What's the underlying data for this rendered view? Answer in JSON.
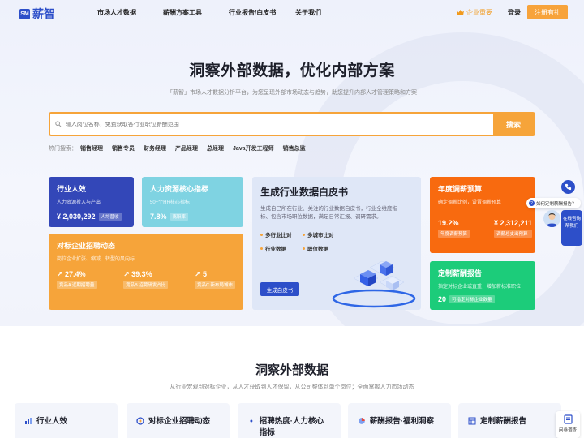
{
  "nav": {
    "logo_mark": "SM",
    "logo_text": "薪智",
    "items": [
      "市场人才数据",
      "薪酬方案工具",
      "行业报告/白皮书",
      "关于我们"
    ],
    "enterprise": "企业重要",
    "login": "登录",
    "register": "注册有礼"
  },
  "hero": {
    "title": "洞察外部数据，优化内部方案",
    "subtitle": "「薪智」市场人才数据分析平台，为您呈现外部市场动态与趋势，助您提升内部人才管理策略和方案"
  },
  "search": {
    "placeholder": "输入岗位名称，免费获取各行业职位薪酬范围",
    "button": "搜索"
  },
  "hot": {
    "label": "热门搜索：",
    "items": [
      "销售经理",
      "销售专员",
      "财务经理",
      "产品经理",
      "总经理",
      "Java开发工程师",
      "销售总监"
    ]
  },
  "cards": {
    "talent": {
      "title": "行业人效",
      "sub": "人力资源投入与产出",
      "value": "¥ 2,030,292",
      "tag": "人均营收"
    },
    "hr": {
      "title": "人力资源核心指标",
      "sub": "50+个HR核心指标",
      "value": "7.8%",
      "tag": "离职率"
    },
    "recruit": {
      "title": "对标企业招聘动态",
      "sub": "岗位企业扩张、缩减、转型的风向标",
      "stats": [
        {
          "value": "27.4%",
          "label": "竞品A 近期招聘量"
        },
        {
          "value": "39.3%",
          "label": "竞品B 招聘研发占比"
        },
        {
          "value": "5",
          "label": "竞品C 新布局城市"
        }
      ]
    },
    "whitepaper": {
      "title": "生成行业数据白皮书",
      "desc": "生成自己所在行业、关注的行业数据白皮书，行业全维度指标、包含市场职位数据，满足日常汇报、调研需求。",
      "features": [
        "多行业比对",
        "多城市比对",
        "行业数据",
        "职位数据"
      ],
      "button": "生成白皮书"
    },
    "budget": {
      "title": "年度调薪预算",
      "sub": "确定调薪比例，设置调薪预算",
      "stats": [
        {
          "value": "19.2%",
          "label": "年度调薪预算"
        },
        {
          "value": "¥ 2,312,211",
          "label": "调薪总支出预算"
        }
      ]
    },
    "custom": {
      "title": "定制薪酬报告",
      "sub": "指定对标企业或直重，增加薪标准职位",
      "value": "20",
      "tag": "可指定对标企业数量"
    }
  },
  "section2": {
    "title": "洞察外部数据",
    "subtitle": "从行业宏观到对标企业，从人才获取到人才保留，从公司整体到单个岗位；全面掌握人力市场动态",
    "features": [
      "行业人效",
      "对标企业招聘动态",
      "招聘热度·人力核心指标",
      "薪酬报告·福利洞察",
      "定制薪酬报告"
    ]
  },
  "float": {
    "bubble": "如何定制薪酬报告？",
    "tab": [
      "在线咨询",
      "帮我们"
    ],
    "survey": "问卷调查"
  },
  "colors": {
    "brand": "#2d4fc9",
    "accent": "#f6a43a"
  },
  "icons": [
    "phone-icon",
    "question-icon",
    "search-icon",
    "crown-icon",
    "survey-icon"
  ]
}
